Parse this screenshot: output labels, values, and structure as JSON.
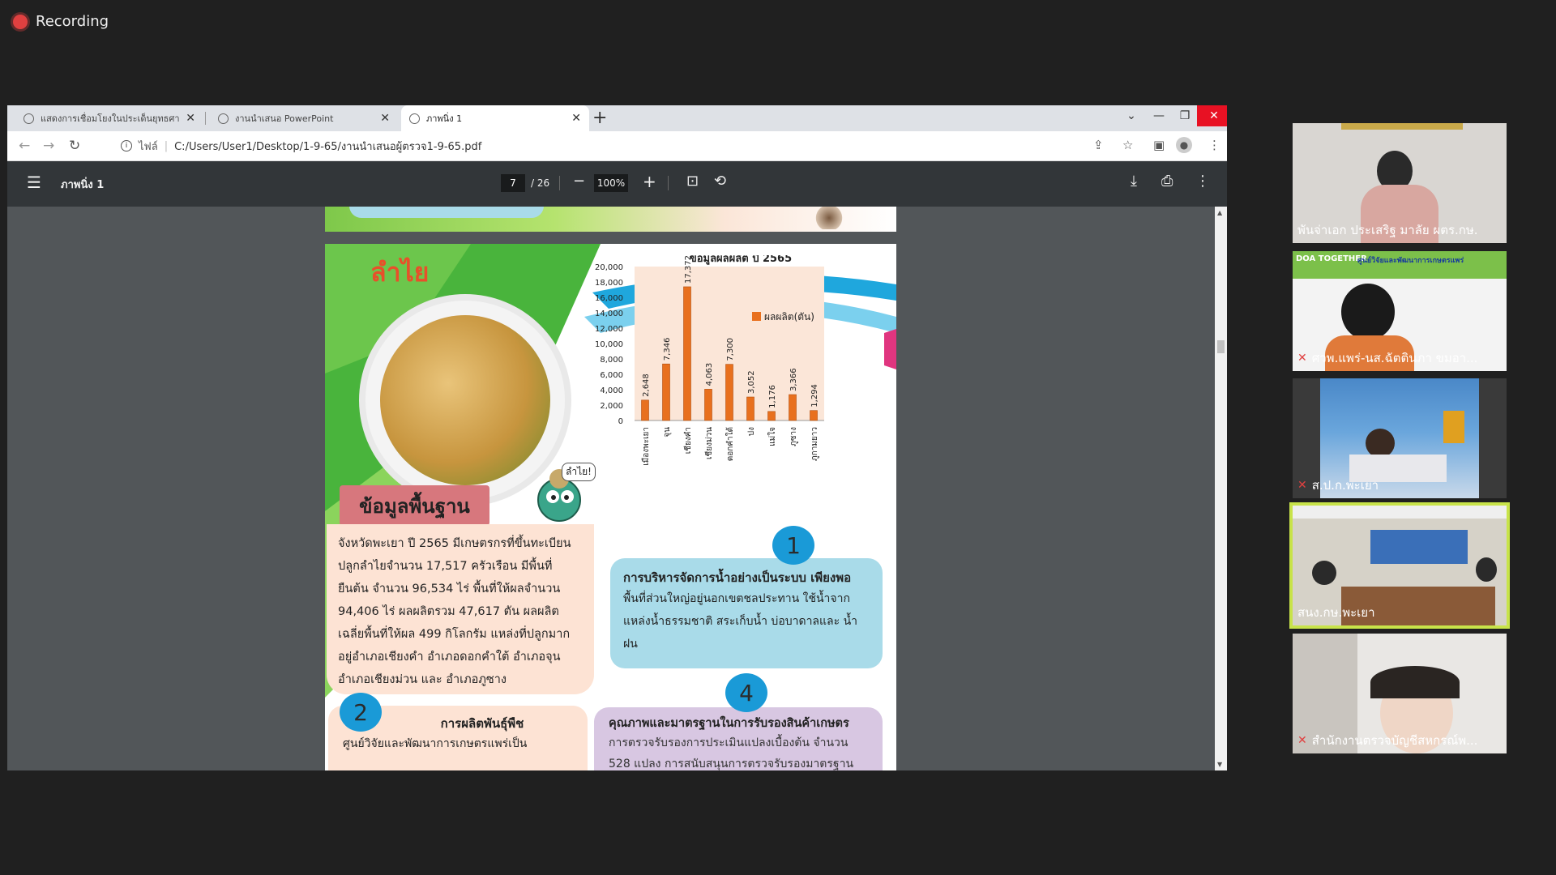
{
  "recording": {
    "label": "Recording"
  },
  "browser": {
    "tabs": [
      {
        "label": "แสดงการเชื่อมโยงในประเด็นยุทธศาสตร์",
        "active": false
      },
      {
        "label": "งานนำเสนอ PowerPoint",
        "active": false
      },
      {
        "label": "ภาพนิ่ง 1",
        "active": true
      }
    ],
    "address": {
      "scheme": "ไฟล์",
      "path": "C:/Users/User1/Desktop/1-9-65/งานนำเสนอผู้ตรวจ1-9-65.pdf"
    }
  },
  "pdf": {
    "title": "ภาพนิ่ง 1",
    "page_current": "7",
    "page_total": "/ 26",
    "zoom": "100%",
    "slide": {
      "title": "ลำไย",
      "mascot_speech": "ลำไย!",
      "background_heading": "ข้อมูลพื้นฐาน",
      "background_text": "จังหวัดพะเยา ปี 2565 มีเกษตรกรที่ขึ้นทะเบียน ปลูกลำไยจำนวน 17,517 ครัวเรือน มีพื้นที่ยืนต้น จำนวน 96,534 ไร่ พื้นที่ให้ผลจำนวน 94,406 ไร่ ผลผลิตรวม 47,617 ตัน ผลผลิตเฉลี่ยพื้นที่ให้ผล 499 กิโลกรัม แหล่งที่ปลูกมากอยู่อำเภอเชียงคำ อำเภอดอกคำใต้ อำเภอจุน อำเภอเชียงม่วน และ อำเภอภูซาง",
      "box1": {
        "number": "1",
        "heading": "การบริหารจัดการน้ำอย่างเป็นระบบ เพียงพอ",
        "text": "พื้นที่ส่วนใหญ่อยู่นอกเขตชลประทาน ใช้น้ำจาก แหล่งน้ำธรรมชาติ สระเก็บน้ำ บ่อบาดาลและ น้ำฝน"
      },
      "box2": {
        "number": "2",
        "heading": "การผลิตพันธุ์พืช",
        "text": "ศูนย์วิจัยและพัฒนาการเกษตรแพร่เป็น"
      },
      "box4": {
        "number": "4",
        "heading": "คุณภาพและมาตรฐานในการรับรองสินค้าเกษตร",
        "text": "การตรวจรับรองการประเมินแปลงเบื้องต้น จำนวน 528 แปลง การสนับสนุนการตรวจรับรองมาตรฐาน"
      }
    }
  },
  "chart_data": {
    "type": "bar",
    "title": "ข้อมูลผลผลิต ปี 2565",
    "categories": [
      "เมืองพะเยา",
      "จุน",
      "เชียงคำ",
      "เชียงม่วน",
      "ดอกคำใต้",
      "ปง",
      "แม่ใจ",
      "ภูซาง",
      "ภูกามยาว"
    ],
    "series": [
      {
        "name": "ผลผลิต(ตัน)",
        "values": [
          2648,
          7346,
          17372,
          4063,
          7300,
          3052,
          1176,
          3366,
          1294
        ]
      }
    ],
    "value_labels": [
      "2,648",
      "7,346",
      "17,372",
      "4,063",
      "7,300",
      "3,052",
      "1,176",
      "3,366",
      "1,294"
    ],
    "yticks": [
      "0",
      "2,000",
      "4,000",
      "6,000",
      "8,000",
      "10,000",
      "12,000",
      "14,000",
      "16,000",
      "18,000",
      "20,000"
    ],
    "ylim": [
      0,
      20000
    ],
    "legend": "right",
    "bar_color": "#e8701e",
    "plot_bg": "#fbe6d8"
  },
  "participants": [
    {
      "name": "พันจ่าเอก ประเสริฐ มาลัย ผตร.กษ.",
      "muted": false,
      "active": false
    },
    {
      "name": "ศวพ.แพร่-นส.ฉัตตินภา ขมอา...",
      "muted": true,
      "active": false
    },
    {
      "name": "ส.ป.ก.พะเยา",
      "muted": true,
      "active": false
    },
    {
      "name": "สนง.กษ.พะเยา",
      "muted": false,
      "active": true
    },
    {
      "name": "สำนักงานตรวจบัญชีสหกรณ์พ...",
      "muted": true,
      "active": false
    }
  ],
  "participant2_banner": "ศูนย์วิจัยและพัฒนาการเกษตรแพร่",
  "participant2_logo": "DOA TOGETHER"
}
